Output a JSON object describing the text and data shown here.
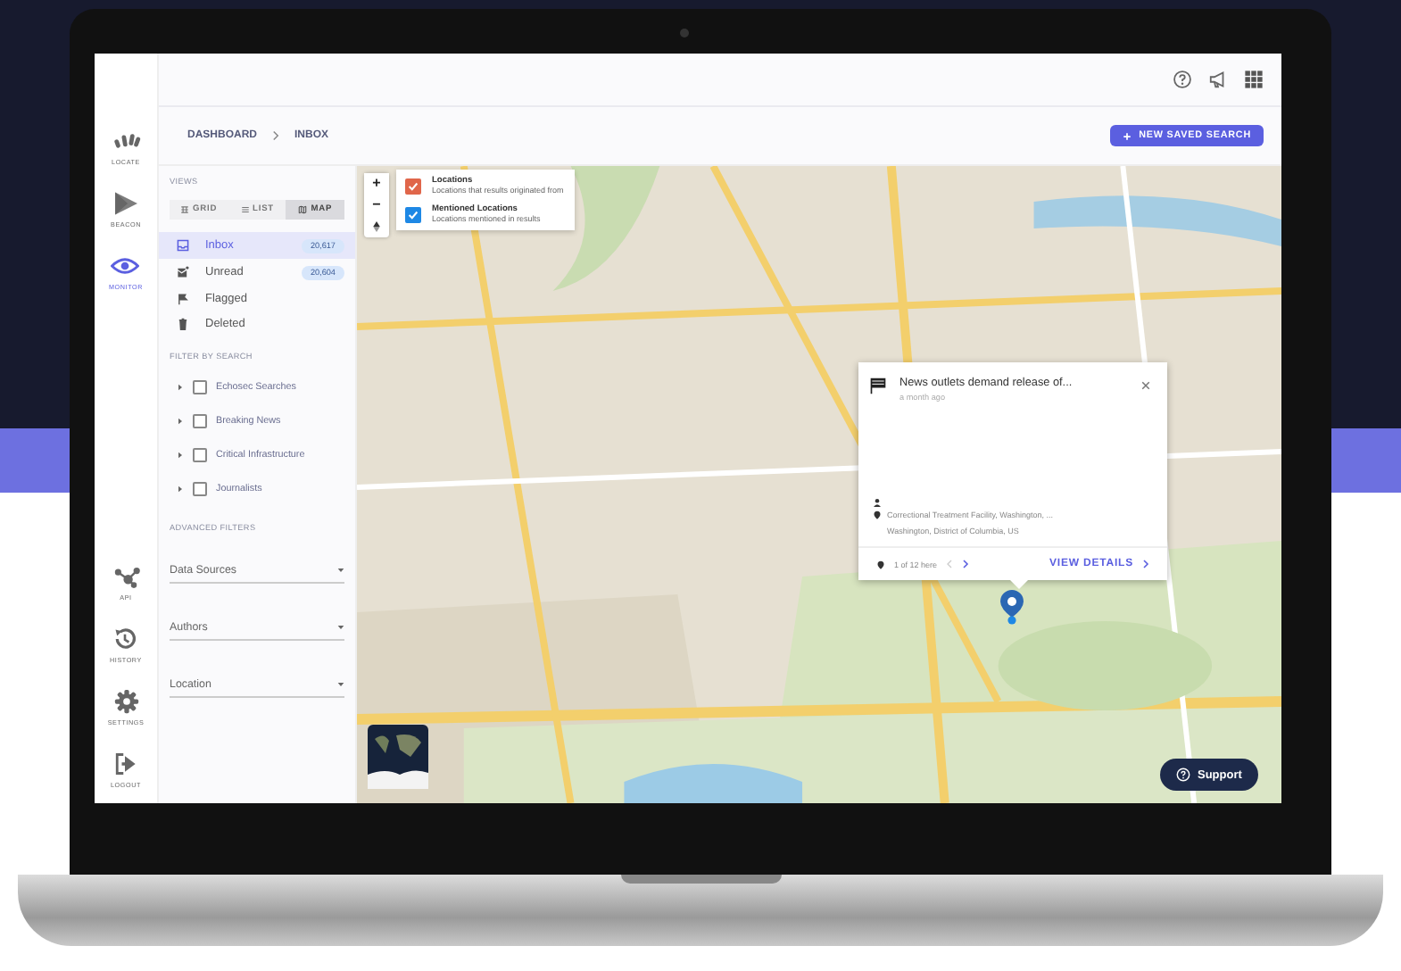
{
  "rail": {
    "top": [
      {
        "label": "LOCATE",
        "selected": false
      },
      {
        "label": "BEACON",
        "selected": false
      },
      {
        "label": "MONITOR",
        "selected": true
      }
    ],
    "bottom": [
      {
        "label": "API"
      },
      {
        "label": "HISTORY"
      },
      {
        "label": "SETTINGS"
      },
      {
        "label": "LOGOUT"
      }
    ]
  },
  "breadcrumb": [
    "DASHBOARD",
    "INBOX"
  ],
  "new_search_button": "NEW SAVED SEARCH",
  "views": {
    "title": "VIEWS",
    "toggles": [
      {
        "label": "GRID",
        "selected": false
      },
      {
        "label": "LIST",
        "selected": false
      },
      {
        "label": "MAP",
        "selected": true
      }
    ],
    "folders": [
      {
        "label": "Inbox",
        "count": "20,617",
        "selected": true
      },
      {
        "label": "Unread",
        "count": "20,604",
        "selected": false
      },
      {
        "label": "Flagged",
        "selected": false
      },
      {
        "label": "Deleted",
        "selected": false
      }
    ]
  },
  "filter_by_search": {
    "title": "FILTER BY SEARCH",
    "items": [
      {
        "label": "Echosec Searches",
        "checked": false,
        "expanded": false
      },
      {
        "label": "Breaking News",
        "checked": false,
        "expanded": false
      },
      {
        "label": "Critical Infrastructure",
        "checked": false,
        "expanded": false
      },
      {
        "label": "Journalists",
        "checked": false,
        "expanded": false
      }
    ]
  },
  "advanced_filters": {
    "title": "ADVANCED FILTERS",
    "dropdowns": [
      {
        "placeholder": "Data Sources"
      },
      {
        "placeholder": "Authors"
      },
      {
        "placeholder": "Location"
      }
    ]
  },
  "map": {
    "zoom": [
      "+",
      "−"
    ],
    "layers": [
      {
        "title": "Locations",
        "subtitle": "Locations that results originated from",
        "checked": true,
        "color": "#e0664a"
      },
      {
        "title": "Mentioned Locations",
        "subtitle": "Locations mentioned in results",
        "checked": true,
        "color": "#1e88e5"
      }
    ],
    "popup": {
      "title": "News outlets demand release of...",
      "time": "a month ago",
      "location": [
        "Correctional Treatment Facility, Washington, ...",
        "Washington, District of Columbia, US"
      ],
      "pager": "1 of 12 here",
      "action": "VIEW DETAILS"
    },
    "support_button": "Support"
  }
}
